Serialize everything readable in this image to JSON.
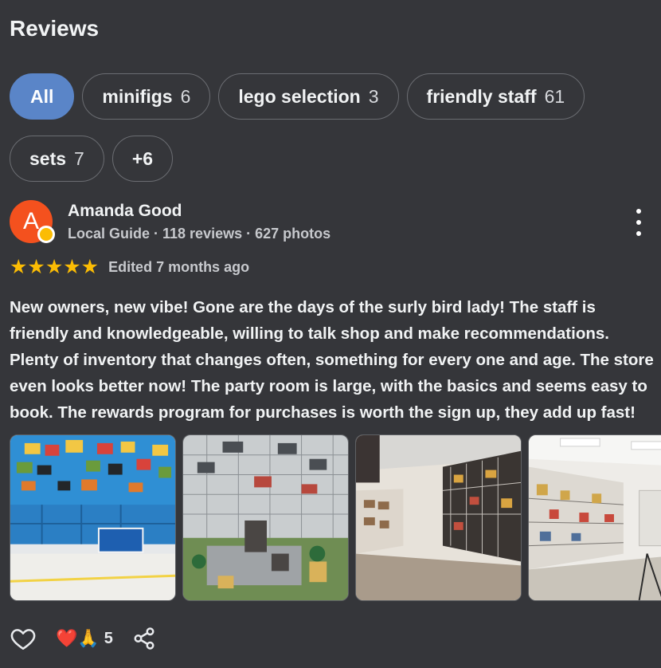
{
  "header": {
    "title": "Reviews"
  },
  "chips": [
    {
      "label": "All",
      "count": ""
    },
    {
      "label": "minifigs",
      "count": "6"
    },
    {
      "label": "lego selection",
      "count": "3"
    },
    {
      "label": "friendly staff",
      "count": "61"
    },
    {
      "label": "sets",
      "count": "7"
    },
    {
      "label": "+6",
      "count": ""
    }
  ],
  "review": {
    "author_initial": "A",
    "author_name": "Amanda Good",
    "author_meta": "Local Guide · 118 reviews · 627 photos",
    "rating": 5,
    "stars": "★★★★★",
    "date": "Edited 7 months ago",
    "text": "New owners, new vibe! Gone are the days of the surly bird lady! The staff is friendly and knowledgeable, willing to talk shop and make recommendations. Plenty of inventory that changes often, something for every one and age. The store even looks better now! The party room is large, with the basics and seems easy to book. The rewards program for purchases is worth the sign up, they add up fast!",
    "reaction_emojis": "❤️🙏",
    "reaction_count": "5"
  },
  "colors": {
    "background": "#35363a",
    "chip_active": "#5a85c8",
    "avatar": "#f4511e",
    "star": "#fbbc04"
  },
  "icons": {
    "more": "more-vert-icon",
    "like": "heart-outline-icon",
    "share": "share-icon"
  }
}
